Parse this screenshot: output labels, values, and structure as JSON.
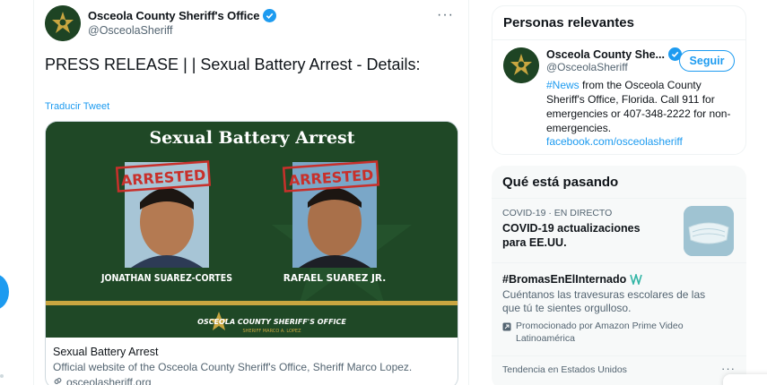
{
  "tweet": {
    "author_name": "Osceola County Sheriff's Office",
    "author_handle": "@OsceolaSheriff",
    "more_glyph": "···",
    "text": "PRESS RELEASE | | Sexual Battery Arrest - Details:",
    "translate_label": "Traducir Tweet",
    "card": {
      "banner": "Sexual Battery Arrest",
      "stamp": "ARRESTED",
      "person1": "JONATHAN SUAREZ-CORTES",
      "person2": "RAFAEL SUAREZ JR.",
      "footer_org": "OSCEOLA COUNTY SHERIFF'S OFFICE",
      "footer_sheriff": "SHERIFF MARCO A. LOPEZ",
      "title": "Sexual Battery Arrest",
      "description": "Official website of the Osceola County Sheriff's Office, Sheriff Marco Lopez.",
      "link": "osceolasheriff.org"
    }
  },
  "relevant": {
    "title": "Personas relevantes",
    "name": "Osceola County She...",
    "handle": "@OsceolaSheriff",
    "follow_label": "Seguir",
    "bio_hashtag": "#News",
    "bio_rest": " from the Osceola County Sheriff's Office, Florida. Call 911 for emergencies or 407-348-2222 for non-emergencies.",
    "url": "facebook.com/osceolasheriff"
  },
  "trending": {
    "title": "Qué está pasando",
    "items": [
      {
        "meta": "COVID-19 · EN DIRECTO",
        "headline": "COVID-19 actualizaciones para EE.UU."
      },
      {
        "headline": "#BromasEnElInternado",
        "description": "Cuéntanos las travesuras escolares de las que tú te sientes orgulloso.",
        "promo": "Promocionado por Amazon Prime Video Latinoamérica"
      },
      {
        "meta": "Tendencia en Estados Unidos",
        "more_glyph": "···"
      }
    ]
  },
  "colors": {
    "accent": "#1d9bf0",
    "card_green": "#1f4826",
    "stamp_red": "#c8302b",
    "gold": "#c9a640"
  }
}
